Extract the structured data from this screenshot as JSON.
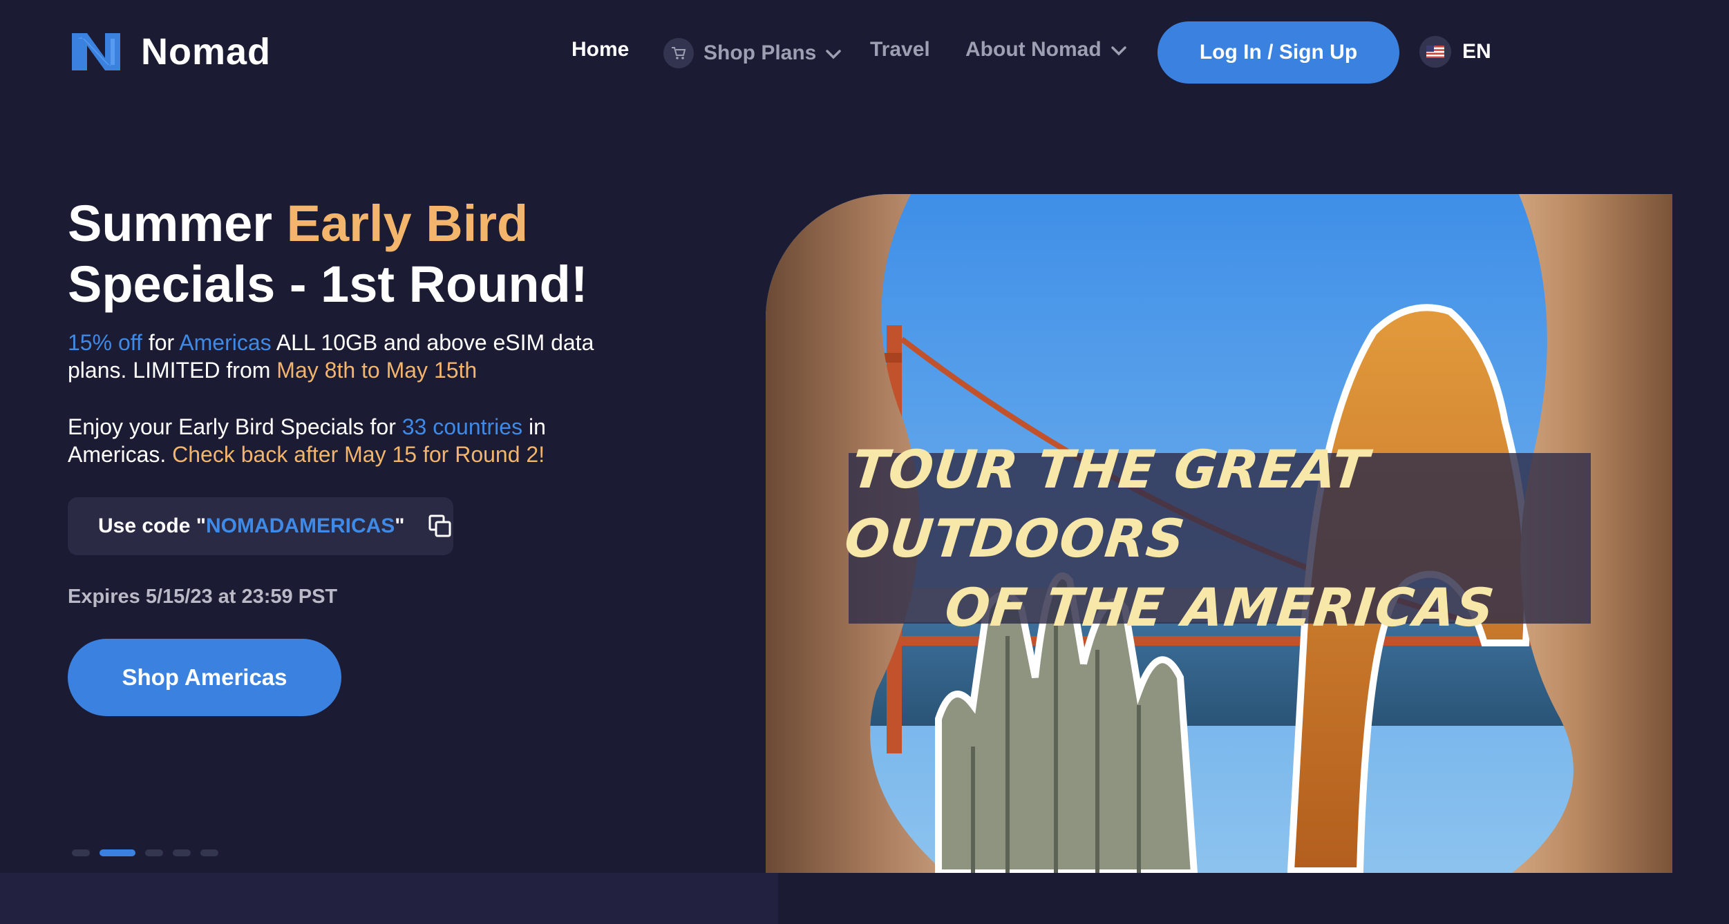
{
  "brand": {
    "name": "Nomad",
    "accent": "#3b82e0",
    "highlight": "#f2b56b",
    "background": "#1b1b33"
  },
  "nav": {
    "home": "Home",
    "shop_plans": "Shop Plans",
    "travel": "Travel",
    "about": "About Nomad",
    "login": "Log In / Sign Up",
    "language": "EN"
  },
  "hero": {
    "headline": {
      "part1": "Summer ",
      "highlight": "Early Bird",
      "line2": "Specials - 1st Round!"
    },
    "para1": {
      "discount": "15% off",
      "t1": " for ",
      "region": "Americas",
      "t2": " ALL 10GB and above eSIM data plans. LIMITED from ",
      "dates": "May 8th to May 15th"
    },
    "para2": {
      "t1": "Enjoy your Early Bird Specials for ",
      "countries": "33 countries",
      "t2": " in Americas. ",
      "round2": "Check back after May 15 for Round 2!"
    },
    "code": {
      "label": "Use code ",
      "quote_open": "\"",
      "value": "NOMADAMERICAS",
      "quote_close": "\""
    },
    "expires": "Expires 5/15/23 at 23:59 PST",
    "cta": "Shop Americas",
    "carousel": {
      "count": 5,
      "active_index": 1
    }
  },
  "banner": {
    "line1": "TOUR THE GREAT OUTDOORS",
    "line2": "OF THE AMERICAS"
  }
}
